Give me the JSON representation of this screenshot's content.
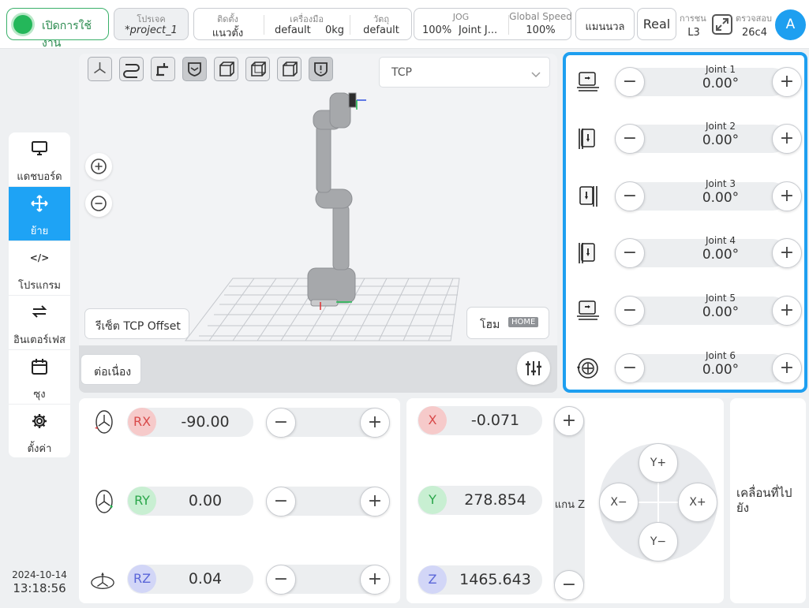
{
  "header": {
    "power_label": "เปิดการใช้งาน",
    "project": {
      "label": "โปรเจค",
      "value": "*project_1"
    },
    "install": {
      "label": "ติดตั้ง",
      "value": "แนวตั้ง"
    },
    "tool": {
      "label": "เครื่องมือ",
      "value": "default",
      "weight": "0kg"
    },
    "object": {
      "label": "วัตถุ",
      "value": "default"
    },
    "jog": {
      "label": "JOG",
      "value": "100%",
      "mode": "Joint J..."
    },
    "global_speed": {
      "label": "Global Speed",
      "value": "100%"
    },
    "manual_label": "แมนนวล",
    "real_label": "Real",
    "collision": {
      "label": "การชน",
      "value": "L3"
    },
    "inspect": {
      "label": "ตรวจสอบ",
      "value": "26c4"
    },
    "avatar_letter": "A"
  },
  "sidebar": {
    "items": [
      {
        "label": "แดชบอร์ด",
        "icon": "monitor-icon"
      },
      {
        "label": "ย้าย",
        "icon": "move-icon",
        "active": true
      },
      {
        "label": "โปรแกรม",
        "icon": "code-icon"
      },
      {
        "label": "อินเตอร์เฟส",
        "icon": "swap-icon"
      },
      {
        "label": "ซุง",
        "icon": "calendar-icon"
      },
      {
        "label": "ตั้งค่า",
        "icon": "gear-icon"
      }
    ],
    "date": "2024-10-14",
    "time": "13:18:56"
  },
  "viewport": {
    "frame_select": "TCP",
    "reset_tcp_label": "รีเซ็ต TCP Offset",
    "home_label": "โฮม",
    "home_badge": "HOME",
    "continuous_label": "ต่อเนื่อง"
  },
  "joints": [
    {
      "name": "Joint 1",
      "value": "0.00°"
    },
    {
      "name": "Joint 2",
      "value": "0.00°"
    },
    {
      "name": "Joint 3",
      "value": "0.00°"
    },
    {
      "name": "Joint 4",
      "value": "0.00°"
    },
    {
      "name": "Joint 5",
      "value": "0.00°"
    },
    {
      "name": "Joint 6",
      "value": "0.00°"
    }
  ],
  "rotation": [
    {
      "axis": "RX",
      "value": "-90.00",
      "color": "#f0a0a0"
    },
    {
      "axis": "RY",
      "value": "0.00",
      "color": "#a8e0b0"
    },
    {
      "axis": "RZ",
      "value": "0.04",
      "color": "#b8bff0"
    }
  ],
  "position": [
    {
      "axis": "X",
      "value": "-0.071"
    },
    {
      "axis": "Y",
      "value": "278.854"
    },
    {
      "axis": "Z",
      "value": "1465.643"
    }
  ],
  "z_axis_label": "แกน Z",
  "dpad": {
    "up": "Y+",
    "down": "Y−",
    "left": "X−",
    "right": "X+"
  },
  "move_to_label": "เคลื่อนที่ไปยัง",
  "accent": "#1ea3f5"
}
